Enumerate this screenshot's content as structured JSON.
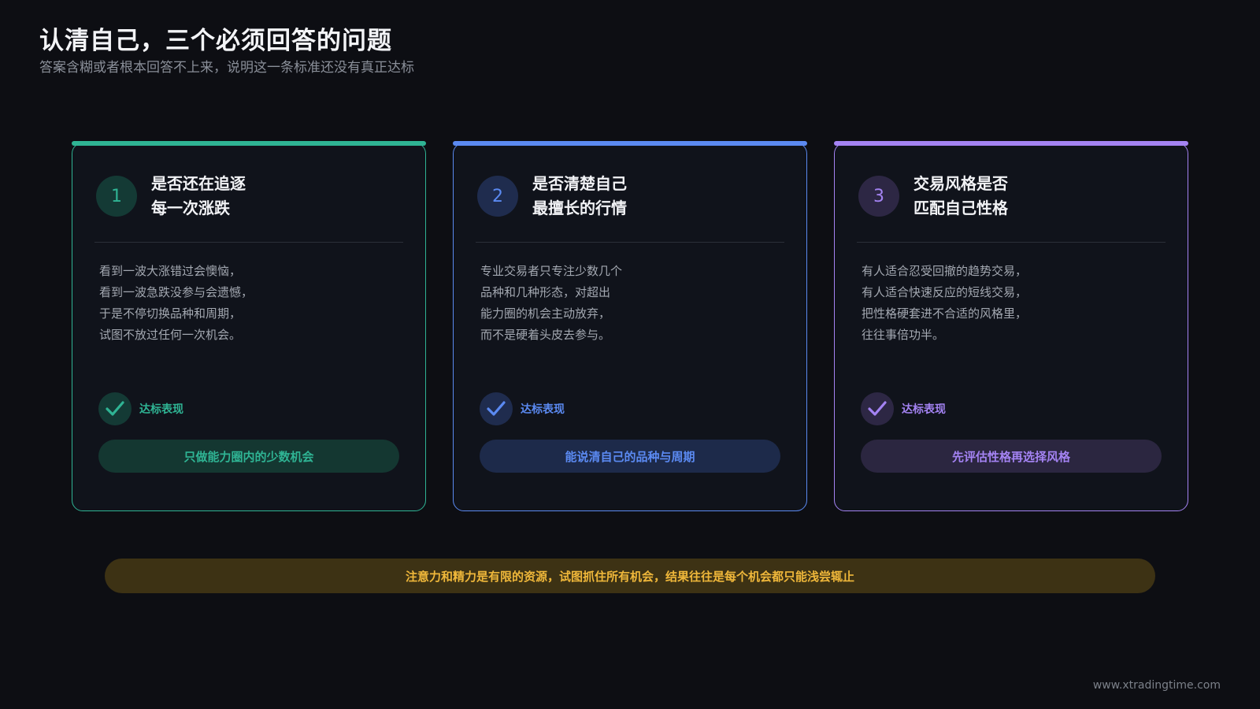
{
  "header": {
    "title": "认清自己，三个必须回答的问题",
    "subtitle": "答案含糊或者根本回答不上来，说明这一条标准还没有真正达标"
  },
  "cards": [
    {
      "number": "1",
      "title_lines": [
        "是否还在追逐",
        "每一次涨跌"
      ],
      "desc_lines": [
        "看到一波大涨错过会懊恼，",
        "看到一波急跌没参与会遗憾，",
        "于是不停切换品种和周期，",
        "试图不放过任何一次机会。"
      ],
      "check_label": "达标表现",
      "check_icon": "checkmark-icon",
      "pill": "只做能力圈内的少数机会",
      "accent": "#2fb494",
      "tint": "#143a35",
      "pill_bg": "#143731"
    },
    {
      "number": "2",
      "title_lines": [
        "是否清楚自己",
        "最擅长的行情"
      ],
      "desc_lines": [
        "专业交易者只专注少数几个",
        "品种和几种形态，对超出",
        "能力圈的机会主动放弃，",
        "而不是硬着头皮去参与。"
      ],
      "check_label": "达标表现",
      "check_icon": "checkmark-icon",
      "pill": "能说清自己的品种与周期",
      "accent": "#5b8af2",
      "tint": "#1f2c4e",
      "pill_bg": "#1d2a4a"
    },
    {
      "number": "3",
      "title_lines": [
        "交易风格是否",
        "匹配自己性格"
      ],
      "desc_lines": [
        "有人适合忍受回撤的趋势交易，",
        "有人适合快速反应的短线交易，",
        "把性格硬套进不合适的风格里，",
        "往往事倍功半。"
      ],
      "check_label": "达标表现",
      "check_icon": "checkmark-icon",
      "pill": "先评估性格再选择风格",
      "accent": "#a483f3",
      "tint": "#2d2744",
      "pill_bg": "#2b2640"
    }
  ],
  "banner": "注意力和精力是有限的资源，试图抓住所有机会，结果往往是每个机会都只能浅尝辄止",
  "footer": "www.xtradingtime.com"
}
